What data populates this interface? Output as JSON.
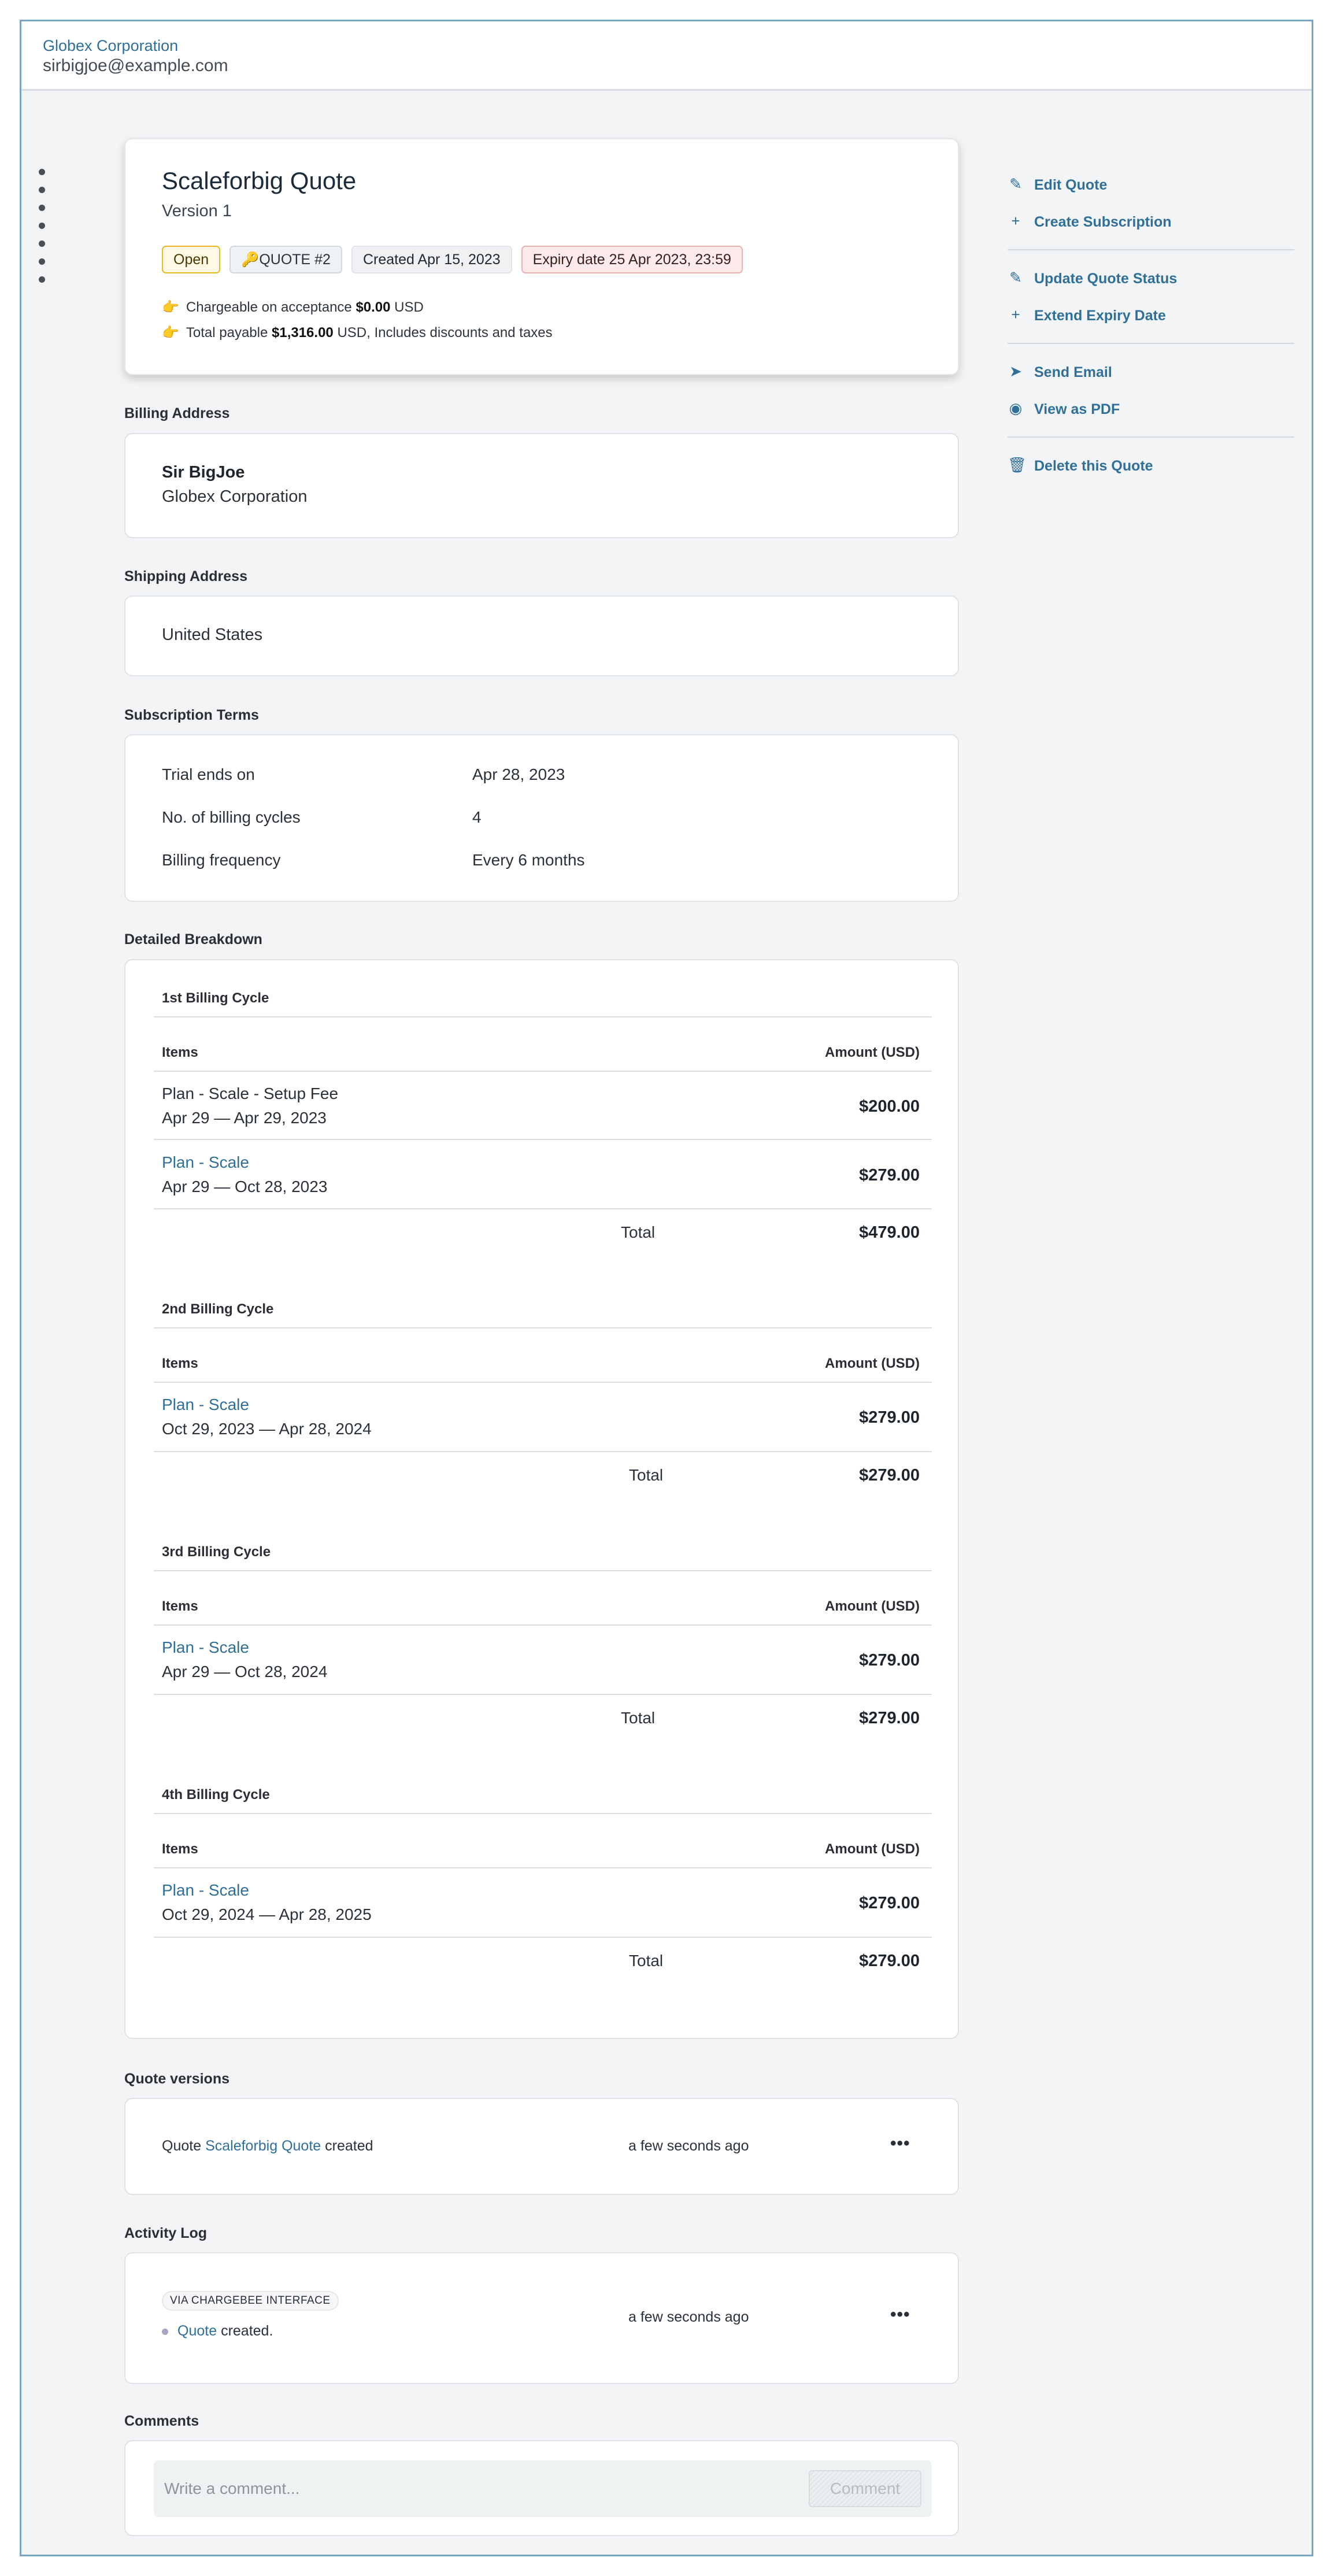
{
  "header": {
    "org": "Globex Corporation",
    "email": "sirbigjoe@example.com"
  },
  "quote": {
    "title": "Scaleforbig Quote",
    "version": "Version 1",
    "badges": {
      "status": "Open",
      "number": "QUOTE #2",
      "created": "Created Apr 15, 2023",
      "expiry": "Expiry date 25 Apr 2023, 23:59"
    },
    "chargeable_prefix": "Chargeable on acceptance",
    "chargeable_amount": "$0.00",
    "chargeable_suffix": "USD",
    "total_prefix": "Total payable",
    "total_amount": "$1,316.00",
    "total_suffix": "USD, Includes discounts and taxes"
  },
  "billing_address": {
    "label": "Billing Address",
    "name": "Sir BigJoe",
    "company": "Globex Corporation"
  },
  "shipping_address": {
    "label": "Shipping Address",
    "country": "United States"
  },
  "subscription_terms": {
    "label": "Subscription Terms",
    "rows": [
      {
        "label": "Trial ends on",
        "value": "Apr 28, 2023"
      },
      {
        "label": "No. of billing cycles",
        "value": "4"
      },
      {
        "label": "Billing frequency",
        "value": "Every 6 months"
      }
    ]
  },
  "breakdown": {
    "label": "Detailed Breakdown",
    "items_header": "Items",
    "amount_header": "Amount (USD)",
    "total_label": "Total",
    "cycles": [
      {
        "title": "1st Billing Cycle",
        "items": [
          {
            "name": "Plan - Scale - Setup Fee",
            "dates": "Apr 29 — Apr 29, 2023",
            "amount": "$200.00"
          },
          {
            "name": "Plan - Scale",
            "dates": "Apr 29 — Oct 28, 2023",
            "amount": "$279.00"
          }
        ],
        "total": "$479.00"
      },
      {
        "title": "2nd Billing Cycle",
        "items": [
          {
            "name": "Plan - Scale",
            "dates": "Oct 29, 2023 — Apr 28, 2024",
            "amount": "$279.00"
          }
        ],
        "total": "$279.00"
      },
      {
        "title": "3rd Billing Cycle",
        "items": [
          {
            "name": "Plan - Scale",
            "dates": "Apr 29 — Oct 28, 2024",
            "amount": "$279.00"
          }
        ],
        "total": "$279.00"
      },
      {
        "title": "4th Billing Cycle",
        "items": [
          {
            "name": "Plan - Scale",
            "dates": "Oct 29, 2024 — Apr 28, 2025",
            "amount": "$279.00"
          }
        ],
        "total": "$279.00"
      }
    ]
  },
  "quote_versions": {
    "label": "Quote versions",
    "prefix": "Quote",
    "link": "Scaleforbig Quote",
    "suffix": "created",
    "time": "a few seconds ago",
    "more": "•••"
  },
  "activity_log": {
    "label": "Activity Log",
    "via": "VIA CHARGEBEE INTERFACE",
    "link": "Quote",
    "suffix": "created.",
    "time": "a few seconds ago",
    "more": "•••"
  },
  "comments": {
    "label": "Comments",
    "placeholder": "Write a comment...",
    "button": "Comment"
  },
  "sidebar": {
    "groups": [
      [
        {
          "icon": "pencil-icon",
          "label": "Edit Quote"
        },
        {
          "icon": "plus-icon",
          "label": "Create Subscription"
        }
      ],
      [
        {
          "icon": "pencil-icon",
          "label": "Update Quote Status"
        },
        {
          "icon": "plus-icon",
          "label": "Extend Expiry Date"
        }
      ],
      [
        {
          "icon": "send-icon",
          "label": "Send Email"
        },
        {
          "icon": "eye-icon",
          "label": "View as PDF"
        }
      ],
      [
        {
          "icon": "trash-icon",
          "label": "Delete this Quote"
        }
      ]
    ]
  }
}
